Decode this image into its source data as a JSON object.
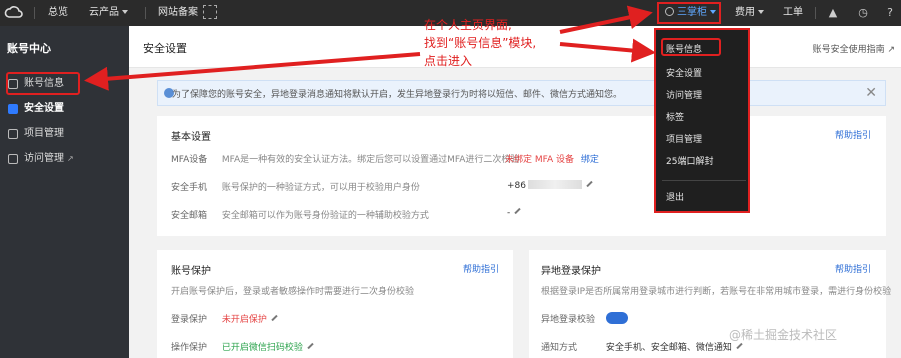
{
  "topbar": {
    "overview": "总览",
    "products": "云产品",
    "icp": "网站备案",
    "account": "三掌柜",
    "billing": "费用",
    "ticket": "工单"
  },
  "sidebar": {
    "title": "账号中心",
    "items": [
      {
        "label": "账号信息"
      },
      {
        "label": "安全设置"
      },
      {
        "label": "项目管理"
      },
      {
        "label": "访问管理"
      }
    ]
  },
  "header": {
    "title": "安全设置",
    "guide": "账号安全使用指南"
  },
  "notice": {
    "text": "为了保障您的账号安全，异地登录消息通知将默认开启，发生异地登录行为时将以短信、邮件、微信方式通知您。"
  },
  "basic": {
    "title": "基本设置",
    "help": "帮助指引",
    "mfa_label": "MFA设备",
    "mfa_desc": "MFA是一种有效的安全认证方法。绑定后您可以设置通过MFA进行二次校验",
    "mfa_status": "未绑定 MFA 设备",
    "mfa_action": "绑定",
    "phone_label": "安全手机",
    "phone_desc": "账号保护的一种验证方式，可以用于校验用户身份",
    "phone_value": "+86",
    "email_label": "安全邮箱",
    "email_desc": "安全邮箱可以作为账号身份验证的一种辅助校验方式",
    "email_value": "-"
  },
  "protect": {
    "title": "账号保护",
    "help": "帮助指引",
    "desc": "开启账号保护后，登录或者敏感操作时需要进行二次身份校验",
    "login_label": "登录保护",
    "login_value": "未开启保护",
    "op_label": "操作保护",
    "op_value": "已开启微信扫码校验"
  },
  "remote": {
    "title": "异地登录保护",
    "help": "帮助指引",
    "desc": "根据登录IP是否所属常用登录城市进行判断，若账号在非常用城市登录，需进行身份校验",
    "verify_label": "异地登录校验",
    "notify_label": "通知方式",
    "notify_value": "安全手机、安全邮箱、微信通知"
  },
  "dropdown": {
    "items": [
      "账号信息",
      "安全设置",
      "访问管理",
      "标签",
      "项目管理",
      "25端口解封"
    ],
    "logout": "退出"
  },
  "annotation": {
    "line1": "在个人主页界面,",
    "line2": "找到“账号信息”模块,",
    "line3": "点击进入"
  },
  "watermark": "@稀土掘金技术社区"
}
